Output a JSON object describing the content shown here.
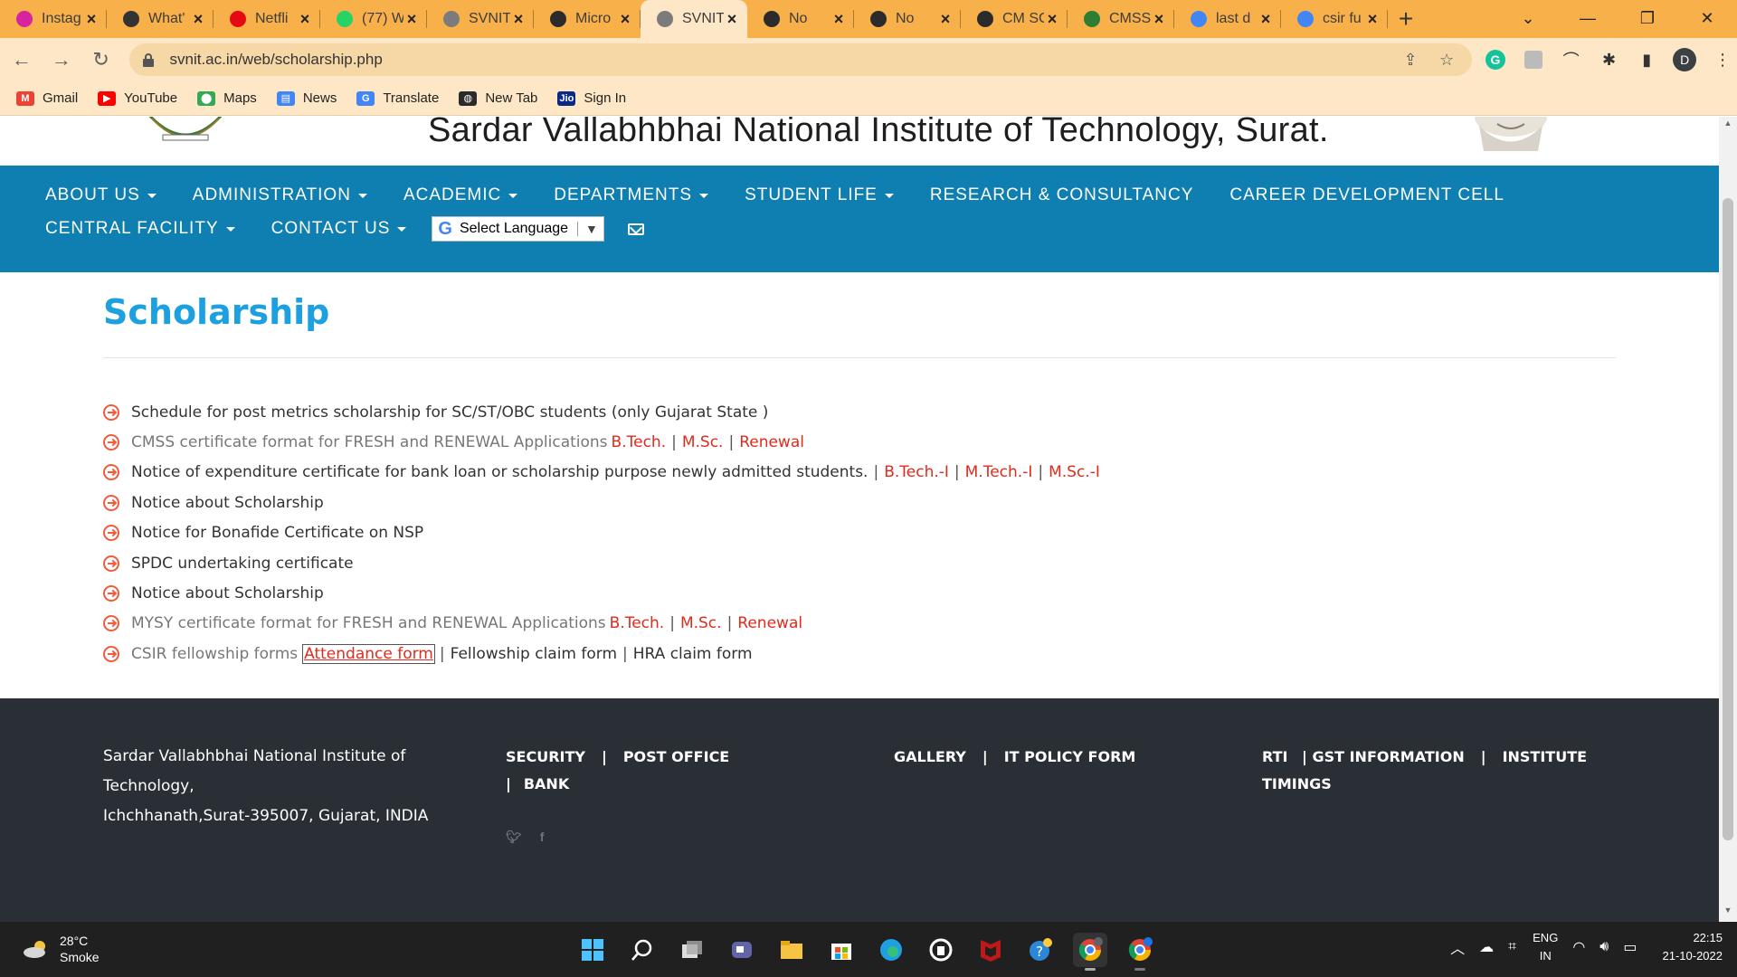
{
  "browser": {
    "tabs": [
      {
        "label": "Instag",
        "favicon": "instagram-icon",
        "color": "#d6249f",
        "active": false
      },
      {
        "label": "What'",
        "favicon": "github-icon",
        "color": "#333333",
        "active": false
      },
      {
        "label": "Netfli",
        "favicon": "netflix-icon",
        "color": "#e50914",
        "active": false
      },
      {
        "label": "(77) W",
        "favicon": "whatsapp-icon",
        "color": "#25d366",
        "active": false
      },
      {
        "label": "SVNIT",
        "favicon": "svnit-icon",
        "color": "#7b7b7b",
        "active": false
      },
      {
        "label": "Micro",
        "favicon": "globe-icon",
        "color": "#2b2b2b",
        "active": false
      },
      {
        "label": "SVNIT",
        "favicon": "svnit-icon",
        "color": "#7b7b7b",
        "active": true
      },
      {
        "label": "No",
        "favicon": "globe-icon",
        "color": "#2b2b2b",
        "active": false
      },
      {
        "label": "No",
        "favicon": "globe-icon",
        "color": "#2b2b2b",
        "active": false
      },
      {
        "label": "CM SC",
        "favicon": "globe-icon",
        "color": "#2b2b2b",
        "active": false
      },
      {
        "label": "CMSS",
        "favicon": "tree-icon",
        "color": "#2e7d32",
        "active": false
      },
      {
        "label": "last d",
        "favicon": "google-icon",
        "color": "#4285f4",
        "active": false
      },
      {
        "label": "csir fu",
        "favicon": "google-icon",
        "color": "#4285f4",
        "active": false
      }
    ],
    "new_tab": "+",
    "window_controls": [
      "⌄",
      "—",
      "❐",
      "✕"
    ],
    "url": "svnit.ac.in/web/scholarship.php",
    "profile_initial": "D",
    "bookmarks": [
      {
        "label": "Gmail",
        "icon": "gmail-icon",
        "color": "#ea4335",
        "glyph": "M"
      },
      {
        "label": "YouTube",
        "icon": "youtube-icon",
        "color": "#ff0000",
        "glyph": "▶"
      },
      {
        "label": "Maps",
        "icon": "maps-icon",
        "color": "#34a853",
        "glyph": "⬤"
      },
      {
        "label": "News",
        "icon": "news-icon",
        "color": "#4285f4",
        "glyph": "▤"
      },
      {
        "label": "Translate",
        "icon": "translate-icon",
        "color": "#4285f4",
        "glyph": "G"
      },
      {
        "label": "New Tab",
        "icon": "globe-icon",
        "color": "#2b2b2b",
        "glyph": "◍"
      },
      {
        "label": "Sign In",
        "icon": "jio-icon",
        "color": "#0a2885",
        "glyph": "Jio"
      }
    ]
  },
  "site": {
    "title": "Sardar Vallabhbhai National Institute of Technology, Surat.",
    "nav_row1": [
      {
        "label": "ABOUT US",
        "dropdown": true
      },
      {
        "label": "ADMINISTRATION",
        "dropdown": true
      },
      {
        "label": "ACADEMIC",
        "dropdown": true
      },
      {
        "label": "DEPARTMENTS",
        "dropdown": true
      },
      {
        "label": "STUDENT LIFE",
        "dropdown": true
      },
      {
        "label": "RESEARCH & CONSULTANCY",
        "dropdown": false
      },
      {
        "label": "CAREER DEVELOPMENT CELL",
        "dropdown": false
      }
    ],
    "nav_row2": [
      {
        "label": "CENTRAL FACILITY",
        "dropdown": true
      },
      {
        "label": "CONTACT US",
        "dropdown": true
      }
    ],
    "language_select": "Select Language",
    "page_title": "Scholarship",
    "items": [
      {
        "text": "Schedule for post metrics scholarship for SC/ST/OBC students (only Gujarat State )",
        "style": "dark",
        "links": []
      },
      {
        "text": "CMSS certificate format for FRESH and RENEWAL Applications",
        "style": "muted",
        "links": [
          "B.Tech.",
          "M.Sc.",
          "Renewal"
        ]
      },
      {
        "text": "Notice of expenditure certificate for bank loan or scholarship purpose newly admitted students.",
        "style": "dark",
        "links": [
          "B.Tech.-I",
          "M.Tech.-I",
          "M.Sc.-I"
        ],
        "lead_pipe": true
      },
      {
        "text": "Notice about Scholarship",
        "style": "dark",
        "links": []
      },
      {
        "text": "Notice for Bonafide Certificate on NSP",
        "style": "dark",
        "links": []
      },
      {
        "text": "SPDC undertaking certificate",
        "style": "dark",
        "links": []
      },
      {
        "text": "Notice about Scholarship",
        "style": "dark",
        "links": []
      },
      {
        "text": "MYSY certificate format for FRESH and RENEWAL Applications",
        "style": "muted",
        "links": [
          "B.Tech.",
          "M.Sc.",
          "Renewal"
        ]
      },
      {
        "text": "CSIR fellowship forms",
        "style": "muted",
        "csir": true,
        "boxed_link": "Attendance form",
        "plain_links": [
          "Fellowship claim form",
          "HRA claim form"
        ]
      }
    ],
    "footer": {
      "address_line1": "Sardar Vallabhbhai National Institute of Technology,",
      "address_line2": "Ichchhanath,Surat-395007, Gujarat, INDIA",
      "col1_a": "SECURITY",
      "col1_b": "POST OFFICE",
      "col1_c": "BANK",
      "col2_a": "GALLERY",
      "col2_b": "IT POLICY FORM",
      "col3_a": "RTI",
      "col3_b": "| GST INFORMATION",
      "col3_c": "INSTITUTE",
      "col3_d": "TIMINGS",
      "sep": "|",
      "social": [
        "twitter-icon",
        "facebook-icon"
      ]
    }
  },
  "taskbar": {
    "temperature": "28°C",
    "condition": "Smoke",
    "lang_line1": "ENG",
    "lang_line2": "IN",
    "time": "22:15",
    "date": "21-10-2022",
    "apps": [
      "windows-start-icon",
      "search-icon",
      "task-view-icon",
      "teams-chat-icon",
      "file-explorer-icon",
      "microsoft-store-icon",
      "edge-icon",
      "app-circle-icon",
      "mcafee-icon",
      "help-icon",
      "chrome-profile-d-icon",
      "chrome-profile-h-icon"
    ]
  },
  "colors": {
    "tabstrip": "#f8b04a",
    "toolbar": "#fde7c6",
    "nav_blue": "#0f7fb1",
    "title_blue": "#1ca0e0",
    "link_red": "#e02b1c",
    "bullet_orange": "#f15a3a",
    "footer": "#2a2e35"
  }
}
